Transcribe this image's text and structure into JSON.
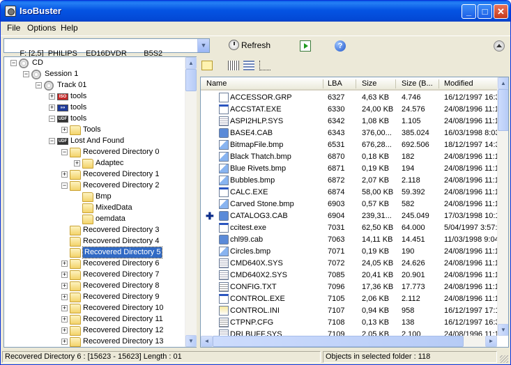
{
  "window": {
    "title": "IsoBuster",
    "minimize": "_",
    "maximize": "□",
    "close": "✕"
  },
  "menu": {
    "file": "File",
    "options": "Options",
    "help": "Help"
  },
  "toolbar": {
    "drive": "F: [2,5]  PHILIPS    ED16DVDR        B5S2",
    "refresh": "Refresh"
  },
  "tree": [
    {
      "label": "CD",
      "icon": "cd-icon",
      "expander": "−",
      "level": 0
    },
    {
      "label": "Session 1",
      "icon": "session-icon",
      "expander": "−",
      "level": 1
    },
    {
      "label": "Track 01",
      "icon": "track-icon",
      "expander": "−",
      "level": 2
    },
    {
      "label": "tools",
      "icon": "iso-icon",
      "expander": "+",
      "level": 3
    },
    {
      "label": "tools",
      "icon": "joliet-icon",
      "expander": "+",
      "level": 3
    },
    {
      "label": "tools",
      "icon": "udf-icon",
      "expander": "−",
      "level": 3
    },
    {
      "label": "Tools",
      "icon": "folder-icon",
      "expander": "+",
      "level": 4
    },
    {
      "label": "Lost And Found",
      "icon": "udf-icon",
      "expander": "−",
      "level": 3
    },
    {
      "label": "Recovered Directory 0",
      "icon": "folder-icon",
      "expander": "−",
      "level": 4
    },
    {
      "label": "Adaptec",
      "icon": "folder-icon",
      "expander": "+",
      "level": 5
    },
    {
      "label": "Recovered Directory 1",
      "icon": "folder-icon",
      "expander": "+",
      "level": 4
    },
    {
      "label": "Recovered Directory 2",
      "icon": "folder-icon",
      "expander": "−",
      "level": 4
    },
    {
      "label": "Bmp",
      "icon": "folder-icon",
      "expander": "",
      "level": 5
    },
    {
      "label": "MixedData",
      "icon": "folder-icon",
      "expander": "",
      "level": 5
    },
    {
      "label": "oemdata",
      "icon": "folder-icon",
      "expander": "",
      "level": 5
    },
    {
      "label": "Recovered Directory 3",
      "icon": "folder-icon",
      "expander": "",
      "level": 4
    },
    {
      "label": "Recovered Directory 4",
      "icon": "folder-icon",
      "expander": "",
      "level": 4
    },
    {
      "label": "Recovered Directory 5",
      "icon": "folder-icon",
      "expander": "",
      "level": 4,
      "selected": true
    },
    {
      "label": "Recovered Directory 6",
      "icon": "folder-icon",
      "expander": "+",
      "level": 4
    },
    {
      "label": "Recovered Directory 7",
      "icon": "folder-icon",
      "expander": "+",
      "level": 4
    },
    {
      "label": "Recovered Directory 8",
      "icon": "folder-icon",
      "expander": "+",
      "level": 4
    },
    {
      "label": "Recovered Directory 9",
      "icon": "folder-icon",
      "expander": "+",
      "level": 4
    },
    {
      "label": "Recovered Directory 10",
      "icon": "folder-icon",
      "expander": "+",
      "level": 4
    },
    {
      "label": "Recovered Directory 11",
      "icon": "folder-icon",
      "expander": "+",
      "level": 4
    },
    {
      "label": "Recovered Directory 12",
      "icon": "folder-icon",
      "expander": "+",
      "level": 4
    },
    {
      "label": "Recovered Directory 13",
      "icon": "folder-icon",
      "expander": "+",
      "level": 4
    }
  ],
  "list": {
    "headers": {
      "name": "Name",
      "lba": "LBA",
      "size": "Size",
      "size_b": "Size (B...",
      "modified": "Modified"
    },
    "rows": [
      {
        "name": "ACCESSOR.GRP",
        "lba": "6327",
        "size": "4,63 KB",
        "size_b": "4.746",
        "modified": "16/12/1997 16:3",
        "icon": "grp"
      },
      {
        "name": "ACCSTAT.EXE",
        "lba": "6330",
        "size": "24,00 KB",
        "size_b": "24.576",
        "modified": "24/08/1996 11:1",
        "icon": "exe"
      },
      {
        "name": "ASPI2HLP.SYS",
        "lba": "6342",
        "size": "1,08 KB",
        "size_b": "1.105",
        "modified": "24/08/1996 11:1",
        "icon": "sys"
      },
      {
        "name": "BASE4.CAB",
        "lba": "6343",
        "size": "376,00...",
        "size_b": "385.024",
        "modified": "16/03/1998 8:03",
        "icon": "cab"
      },
      {
        "name": "BitmapFile.bmp",
        "lba": "6531",
        "size": "676,28...",
        "size_b": "692.506",
        "modified": "18/12/1997 14:3",
        "icon": "bmp"
      },
      {
        "name": "Black Thatch.bmp",
        "lba": "6870",
        "size": "0,18 KB",
        "size_b": "182",
        "modified": "24/08/1996 11:1",
        "icon": "bmp"
      },
      {
        "name": "Blue Rivets.bmp",
        "lba": "6871",
        "size": "0,19 KB",
        "size_b": "194",
        "modified": "24/08/1996 11:1",
        "icon": "bmp"
      },
      {
        "name": "Bubbles.bmp",
        "lba": "6872",
        "size": "2,07 KB",
        "size_b": "2.118",
        "modified": "24/08/1996 11:1",
        "icon": "bmp"
      },
      {
        "name": "CALC.EXE",
        "lba": "6874",
        "size": "58,00 KB",
        "size_b": "59.392",
        "modified": "24/08/1996 11:1",
        "icon": "exe"
      },
      {
        "name": "Carved Stone.bmp",
        "lba": "6903",
        "size": "0,57 KB",
        "size_b": "582",
        "modified": "24/08/1996 11:1",
        "icon": "bmp"
      },
      {
        "name": "CATALOG3.CAB",
        "lba": "6904",
        "size": "239,31...",
        "size_b": "245.049",
        "modified": "17/03/1998 10:1",
        "icon": "cab",
        "marker": "✚"
      },
      {
        "name": "ccitest.exe",
        "lba": "7031",
        "size": "62,50 KB",
        "size_b": "64.000",
        "modified": "5/04/1997 3:57:",
        "icon": "exe"
      },
      {
        "name": "chl99.cab",
        "lba": "7063",
        "size": "14,11 KB",
        "size_b": "14.451",
        "modified": "11/03/1998 9:04",
        "icon": "cab"
      },
      {
        "name": "Circles.bmp",
        "lba": "7071",
        "size": "0,19 KB",
        "size_b": "190",
        "modified": "24/08/1996 11:1",
        "icon": "bmp"
      },
      {
        "name": "CMD640X.SYS",
        "lba": "7072",
        "size": "24,05 KB",
        "size_b": "24.626",
        "modified": "24/08/1996 11:1",
        "icon": "sys"
      },
      {
        "name": "CMD640X2.SYS",
        "lba": "7085",
        "size": "20,41 KB",
        "size_b": "20.901",
        "modified": "24/08/1996 11:1",
        "icon": "sys"
      },
      {
        "name": "CONFIG.TXT",
        "lba": "7096",
        "size": "17,36 KB",
        "size_b": "17.773",
        "modified": "24/08/1996 11:1",
        "icon": "txt"
      },
      {
        "name": "CONTROL.EXE",
        "lba": "7105",
        "size": "2,06 KB",
        "size_b": "2.112",
        "modified": "24/08/1996 11:1",
        "icon": "exe"
      },
      {
        "name": "CONTROL.INI",
        "lba": "7107",
        "size": "0,94 KB",
        "size_b": "958",
        "modified": "16/12/1997 17:1",
        "icon": "ini"
      },
      {
        "name": "CTPNP.CFG",
        "lba": "7108",
        "size": "0,13 KB",
        "size_b": "138",
        "modified": "16/12/1997 16:3",
        "icon": "txt"
      },
      {
        "name": "DRLBUFF.SYS",
        "lba": "7109",
        "size": "2,05 KB",
        "size_b": "2.100",
        "modified": "24/08/1996 11:1",
        "icon": "sys"
      }
    ]
  },
  "status": {
    "left": "Recovered Directory 6 : [15623 - 15623]  Length : 01",
    "right": "Objects in selected folder : 118"
  }
}
